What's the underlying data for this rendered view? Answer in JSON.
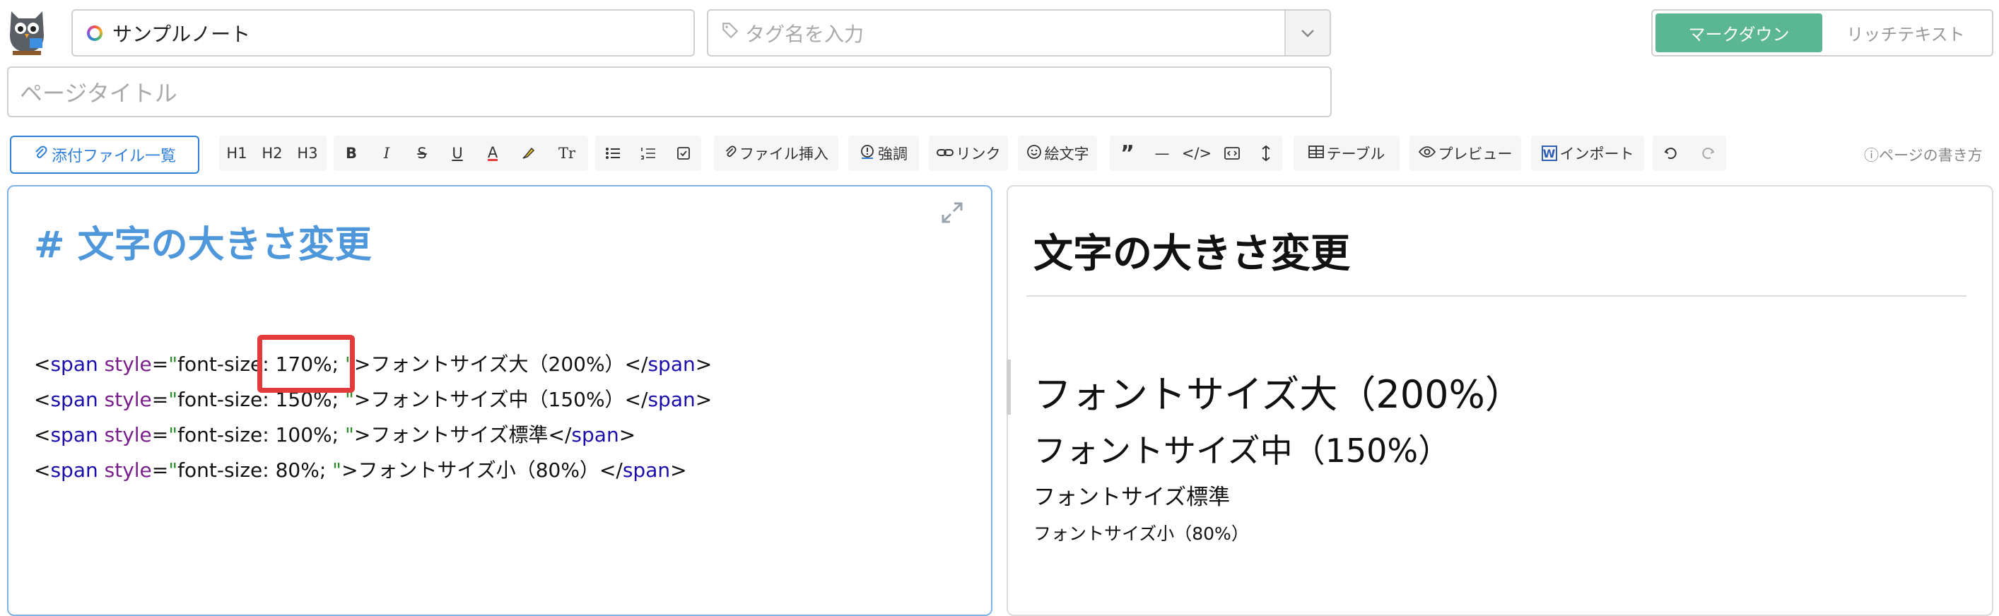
{
  "header": {
    "note_name": "サンプルノート",
    "tag_placeholder": "タグ名を入力",
    "modes": [
      "マークダウン",
      "リッチテキスト"
    ],
    "active_mode": "マークダウン"
  },
  "page": {
    "title_placeholder": "ページタイトル"
  },
  "toolbar": {
    "attach_label": "添付ファイル一覧",
    "headings": [
      "H1",
      "H2",
      "H3"
    ],
    "file_insert": "ファイル挿入",
    "emphasis": "強調",
    "link": "リンク",
    "emoji": "絵文字",
    "table": "テーブル",
    "preview": "プレビュー",
    "import": "インポート",
    "help": "ページの書き方"
  },
  "editor": {
    "heading": "# 文字の大きさ変更",
    "lines": [
      {
        "style_value": "font-size: 170%; ",
        "text": "フォントサイズ大（200%）"
      },
      {
        "style_value": "font-size: 150%; ",
        "text": "フォントサイズ中（150%）"
      },
      {
        "style_value": "font-size: 100%; ",
        "text": "フォントサイズ標準"
      },
      {
        "style_value": "font-size: 80%; ",
        "text": "フォントサイズ小（80%）"
      }
    ]
  },
  "preview": {
    "heading": "文字の大きさ変更",
    "lines": [
      "フォントサイズ大（200%）",
      "フォントサイズ中（150%）",
      "フォントサイズ標準",
      "フォントサイズ小（80%）"
    ]
  },
  "colors": {
    "accent": "#5bb694",
    "link_blue": "#2f80d8",
    "highlight_red": "#e33b3b"
  }
}
